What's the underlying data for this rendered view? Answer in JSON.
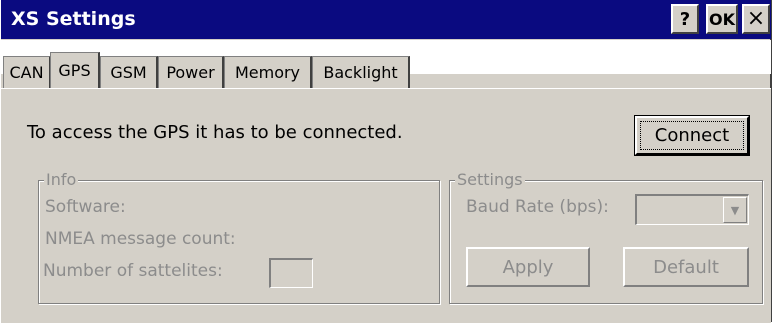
{
  "window": {
    "title": "XS Settings",
    "help_label": "?",
    "ok_label": "OK",
    "close_label": "×"
  },
  "tabs": [
    {
      "label": "CAN",
      "active": false
    },
    {
      "label": "GPS",
      "active": true
    },
    {
      "label": "GSM",
      "active": false
    },
    {
      "label": "Power",
      "active": false
    },
    {
      "label": "Memory",
      "active": false
    },
    {
      "label": "Backlight",
      "active": false
    }
  ],
  "gps": {
    "message": "To access the GPS it has to be connected.",
    "connect_label": "Connect",
    "info": {
      "legend": "Info",
      "software_label": "Software:",
      "nmea_label": "NMEA message count:",
      "satellites_label": "Number of sattelites:",
      "satellites_value": ""
    },
    "settings": {
      "legend": "Settings",
      "baud_label": "Baud Rate (bps):",
      "baud_value": "",
      "apply_label": "Apply",
      "default_label": "Default"
    }
  },
  "colors": {
    "titlebar": "#0a0a80",
    "face": "#d4d0c8",
    "disabled_text": "#8c8c8c"
  }
}
